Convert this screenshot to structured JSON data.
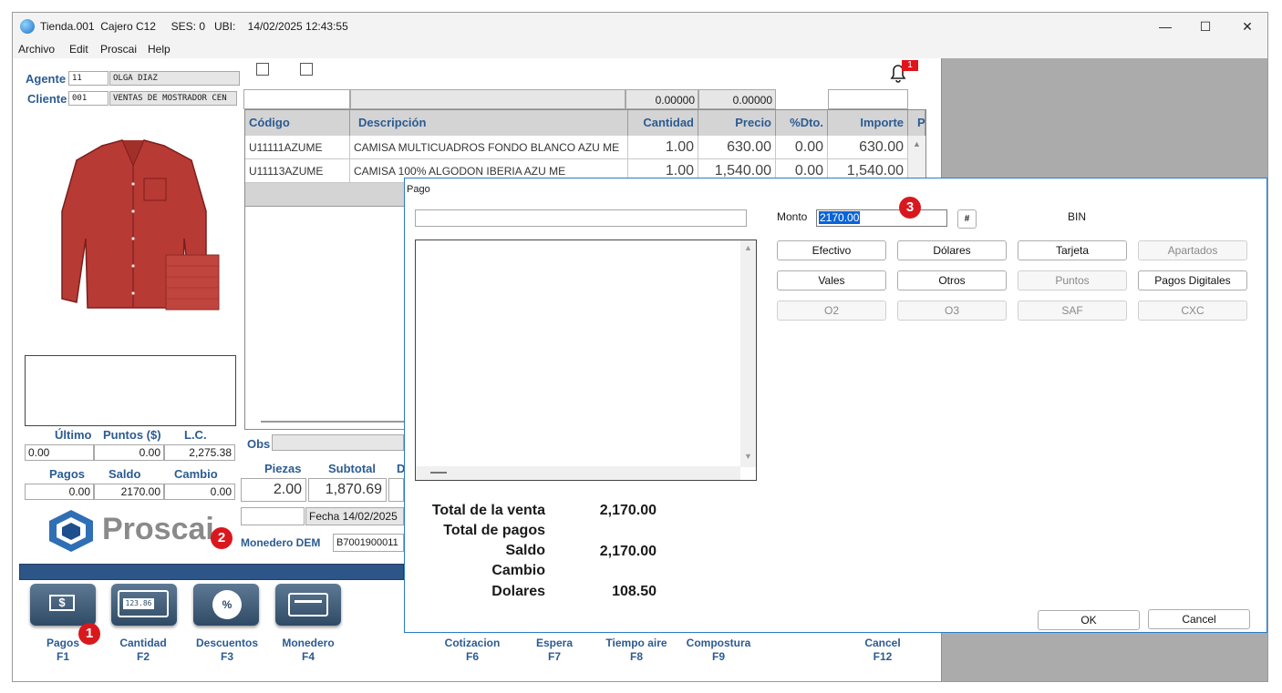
{
  "window": {
    "title": "Tienda.001  Cajero C12     SES: 0   UBI:    14/02/2025 12:43:55",
    "minimize": "—",
    "maximize": "☐",
    "close": "✕"
  },
  "menu": [
    "Archivo",
    "Edit",
    "Proscai",
    "Help"
  ],
  "header": {
    "agente_label": "Agente",
    "agente_code": "11",
    "agente_name": "OLGA DIAZ",
    "cliente_label": "Cliente",
    "cliente_code": "001",
    "cliente_name": "VENTAS DE MOSTRADOR CEN",
    "notification_count": "1"
  },
  "grid": {
    "top_values": [
      "0.00000",
      "0.00000"
    ],
    "columns": [
      "Código",
      "Descripción",
      "Cantidad",
      "Precio",
      "%Dto.",
      "Importe",
      "P"
    ],
    "rows": [
      [
        "U11111AZUME",
        "CAMISA MULTICUADROS FONDO BLANCO AZU ME",
        "1.00",
        "630.00",
        "0.00",
        "630.00"
      ],
      [
        "U11113AZUME",
        "CAMISA 100% ALGODON IBERIA AZU ME",
        "1.00",
        "1,540.00",
        "0.00",
        "1,540.00"
      ]
    ]
  },
  "left_stats": {
    "ultimo_label": "Último",
    "puntos_label": "Puntos ($)",
    "lc_label": "L.C.",
    "ultimo": "0.00",
    "puntos": "0.00",
    "lc": "2,275.38",
    "pagos_label": "Pagos",
    "saldo_label": "Saldo",
    "cambio_label": "Cambio",
    "pagos": "0.00",
    "saldo": "2170.00",
    "cambio": "0.00"
  },
  "summary": {
    "obs_label": "Obs",
    "piezas_label": "Piezas",
    "subtotal_label": "Subtotal",
    "d_label": "D",
    "piezas": "2.00",
    "subtotal": "1,870.69",
    "fecha": "Fecha 14/02/2025",
    "monedero_label": "Monedero DEM",
    "monedero_value": "B7001900011"
  },
  "logo": {
    "text": "Proscai"
  },
  "footer": {
    "buttons": [
      {
        "label": "Pagos",
        "key": "F1"
      },
      {
        "label": "Cantidad",
        "key": "F2"
      },
      {
        "label": "Descuentos",
        "key": "F3"
      },
      {
        "label": "Monedero",
        "key": "F4"
      },
      {
        "label": "Cotizacion",
        "key": "F6"
      },
      {
        "label": "Espera",
        "key": "F7"
      },
      {
        "label": "Tiempo aire",
        "key": "F8"
      },
      {
        "label": "Compostura",
        "key": "F9"
      },
      {
        "label": "Cancel",
        "key": "F12"
      }
    ],
    "cantidad_display": "123.86"
  },
  "annotations": [
    "1",
    "2",
    "3"
  ],
  "dialog": {
    "title": "Pago",
    "monto_label": "Monto",
    "monto_value": "2170.00",
    "hash_button": "#",
    "bin_label": "BIN",
    "buttons_row1": [
      "Efectivo",
      "Dólares",
      "Tarjeta",
      "Apartados"
    ],
    "buttons_row2": [
      "Vales",
      "Otros",
      "Puntos",
      "Pagos Digitales"
    ],
    "buttons_row3": [
      "O2",
      "O3",
      "SAF",
      "CXC"
    ],
    "totals": [
      {
        "label": "Total de la venta",
        "value": "2,170.00"
      },
      {
        "label": "Total de pagos",
        "value": ""
      },
      {
        "label": "Saldo",
        "value": "2,170.00"
      },
      {
        "label": "Cambio",
        "value": ""
      },
      {
        "label": "Dolares",
        "value": "108.50"
      }
    ],
    "ok": "OK",
    "cancel": "Cancel"
  },
  "colors": {
    "accent": "#2b5b92",
    "badge": "#d9181e",
    "dialog_border": "#2b7bc7"
  }
}
